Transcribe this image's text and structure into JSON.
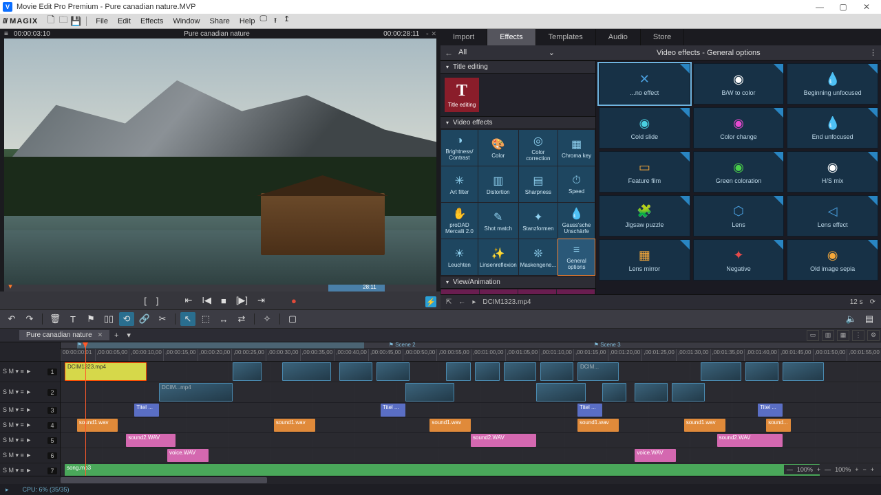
{
  "window": {
    "title": "Movie Edit Pro Premium - Pure canadian nature.MVP",
    "appchar": "V"
  },
  "brand": "MAGIX",
  "menu": {
    "file": "File",
    "edit": "Edit",
    "effects": "Effects",
    "window": "Window",
    "share": "Share",
    "help": "Help"
  },
  "preview": {
    "pos": "00:00:03:10",
    "title": "Pure canadian nature",
    "dur": "00:00:28:11",
    "scrub_label": "28:11"
  },
  "transport": {
    "q": "⚡"
  },
  "tabs": {
    "import": "Import",
    "effects": "Effects",
    "templates": "Templates",
    "audio": "Audio",
    "store": "Store"
  },
  "sub": {
    "all": "All",
    "header": "Video effects - General options"
  },
  "fx_sections": {
    "title": "Title editing",
    "title_tile": "Title editing",
    "video": "Video effects",
    "view": "View/Animation"
  },
  "fx_grid": [
    {
      "l": "Brightness/\nContrast",
      "i": "◑"
    },
    {
      "l": "Color",
      "i": "🎨"
    },
    {
      "l": "Color\ncorrection",
      "i": "◎"
    },
    {
      "l": "Chroma key",
      "i": "▦"
    },
    {
      "l": "Art filter",
      "i": "✳"
    },
    {
      "l": "Distortion",
      "i": "▥"
    },
    {
      "l": "Sharpness",
      "i": "▤"
    },
    {
      "l": "Speed",
      "i": "⏱"
    },
    {
      "l": "proDAD\nMercalli 2.0",
      "i": "✋"
    },
    {
      "l": "Shot match",
      "i": "✎"
    },
    {
      "l": "Stanzformen",
      "i": "✦"
    },
    {
      "l": "Gauss'sche\nUnschärfe",
      "i": "💧"
    },
    {
      "l": "Leuchten",
      "i": "☀"
    },
    {
      "l": "Linsenreflexion",
      "i": "✨"
    },
    {
      "l": "Maskengene...",
      "i": "❊"
    },
    {
      "l": "General\noptions",
      "i": "≡",
      "sel": true
    }
  ],
  "presets": [
    {
      "l": "...no effect",
      "i": "✕",
      "c": "#4aa0e0",
      "sel": true
    },
    {
      "l": "B/W to color",
      "i": "◉",
      "c": "#ffffff"
    },
    {
      "l": "Beginning unfocused",
      "i": "💧",
      "c": "#f6a83a"
    },
    {
      "l": "Cold slide",
      "i": "◉",
      "c": "#4ad0e0"
    },
    {
      "l": "Color change",
      "i": "◉",
      "c": "#e64ad0"
    },
    {
      "l": "End unfocused",
      "i": "💧",
      "c": "#f6a83a"
    },
    {
      "l": "Feature film",
      "i": "▭",
      "c": "#f6a83a"
    },
    {
      "l": "Green coloration",
      "i": "◉",
      "c": "#4ad04a"
    },
    {
      "l": "H/S mix",
      "i": "◉",
      "c": "#ffffff"
    },
    {
      "l": "Jigsaw puzzle",
      "i": "🧩",
      "c": "#f6a83a"
    },
    {
      "l": "Lens",
      "i": "⬡",
      "c": "#4aa0e0"
    },
    {
      "l": "Lens effect",
      "i": "◁",
      "c": "#4aa0e0"
    },
    {
      "l": "Lens mirror",
      "i": "▦",
      "c": "#f6a83a"
    },
    {
      "l": "Negative",
      "i": "✦",
      "c": "#e64a4a"
    },
    {
      "l": "Old image sepia",
      "i": "◉",
      "c": "#f6a83a"
    }
  ],
  "fx_foot": {
    "file": "DCIM1323.mp4",
    "dur": "12 s"
  },
  "seq": {
    "name": "Pure canadian nature"
  },
  "ruler_ticks": [
    "00:00:00:01",
    ",00:00:05,00",
    ",00:00:10,00",
    ",00:00:15,00",
    ",00:00:20,00",
    ",00:00:25,00",
    ",00:00:30,00",
    ",00:00:35,00",
    ",00:00:40,00",
    ",00:00:45,00",
    ",00:00:50,00",
    ",00:00:55,00",
    ",00:01:00,00",
    ",00:01:05,00",
    ",00:01:10,00",
    ",00:01:15,00",
    ",00:01:20,00",
    ",00:01:25,00",
    ",00:01:30,00",
    ",00:01:35,00",
    ",00:01:40,00",
    ",00:01:45,00",
    ",00:01:50,00",
    ",00:01:55,00"
  ],
  "scenes": [
    {
      "n": "1",
      "p": 2
    },
    {
      "n": "Scene 2",
      "p": 40
    },
    {
      "n": "Scene 3",
      "p": 65
    }
  ],
  "scene_seg": {
    "l": 2,
    "w": 35
  },
  "tracks": {
    "t1": [
      {
        "t": "vid",
        "l": 0.5,
        "w": 10,
        "lbl": "DCIM1323.mp4",
        "sel": true
      },
      {
        "t": "vid",
        "l": 21,
        "w": 3.5
      },
      {
        "t": "vid",
        "l": 27,
        "w": 6
      },
      {
        "t": "vid",
        "l": 34,
        "w": 4
      },
      {
        "t": "vid",
        "l": 38.5,
        "w": 4
      },
      {
        "t": "vid",
        "l": 47,
        "w": 3
      },
      {
        "t": "vid",
        "l": 50.5,
        "w": 3
      },
      {
        "t": "vid",
        "l": 54,
        "w": 4
      },
      {
        "t": "vid",
        "l": 58.5,
        "w": 4
      },
      {
        "t": "vid",
        "l": 63,
        "w": 5,
        "lbl": "DCIM..."
      },
      {
        "t": "vid",
        "l": 78,
        "w": 5
      },
      {
        "t": "vid",
        "l": 83.5,
        "w": 4
      },
      {
        "t": "vid",
        "l": 88,
        "w": 5
      }
    ],
    "t2": [
      {
        "t": "vid",
        "l": 12,
        "w": 9,
        "lbl": "DCIM...mp4"
      },
      {
        "t": "vid",
        "l": 42,
        "w": 6
      },
      {
        "t": "vid",
        "l": 58,
        "w": 6
      },
      {
        "t": "vid",
        "l": 66,
        "w": 3
      },
      {
        "t": "vid",
        "l": 70,
        "w": 4
      },
      {
        "t": "vid",
        "l": 74.5,
        "w": 4
      }
    ],
    "t3": [
      {
        "t": "ttl",
        "l": 9,
        "w": 3,
        "lbl": "Titel   ..."
      },
      {
        "t": "ttl",
        "l": 39,
        "w": 3,
        "lbl": "Titel   ..."
      },
      {
        "t": "ttl",
        "l": 63,
        "w": 3,
        "lbl": "Titel   ..."
      },
      {
        "t": "ttl",
        "l": 85,
        "w": 3,
        "lbl": "Titel   ..."
      }
    ],
    "t4": [
      {
        "t": "snd1",
        "l": 2,
        "w": 5,
        "lbl": "sound1.wav"
      },
      {
        "t": "snd1",
        "l": 26,
        "w": 5,
        "lbl": "sound1.wav"
      },
      {
        "t": "snd1",
        "l": 45,
        "w": 5,
        "lbl": "sound1.wav"
      },
      {
        "t": "snd1",
        "l": 63,
        "w": 5,
        "lbl": "sound1.wav"
      },
      {
        "t": "snd1",
        "l": 76,
        "w": 5,
        "lbl": "sound1.wav"
      },
      {
        "t": "snd1",
        "l": 86,
        "w": 3,
        "lbl": "sound..."
      }
    ],
    "t5": [
      {
        "t": "snd2",
        "l": 8,
        "w": 6,
        "lbl": "sound2.WAV"
      },
      {
        "t": "snd2",
        "l": 50,
        "w": 8,
        "lbl": "sound2.WAV"
      },
      {
        "t": "snd2",
        "l": 80,
        "w": 8,
        "lbl": "sound2.WAV"
      }
    ],
    "t6": [
      {
        "t": "snd2",
        "l": 13,
        "w": 5,
        "lbl": "voice.WAV"
      },
      {
        "t": "snd2",
        "l": 70,
        "w": 5,
        "lbl": "voice.WAV"
      }
    ],
    "t7": [
      {
        "t": "snd3",
        "l": 0.5,
        "w": 92,
        "lbl": "song.mp3"
      }
    ]
  },
  "status": {
    "cpu": "CPU: 6% (35/35)"
  },
  "zoom": {
    "z1": "100%",
    "z2": "100%"
  }
}
